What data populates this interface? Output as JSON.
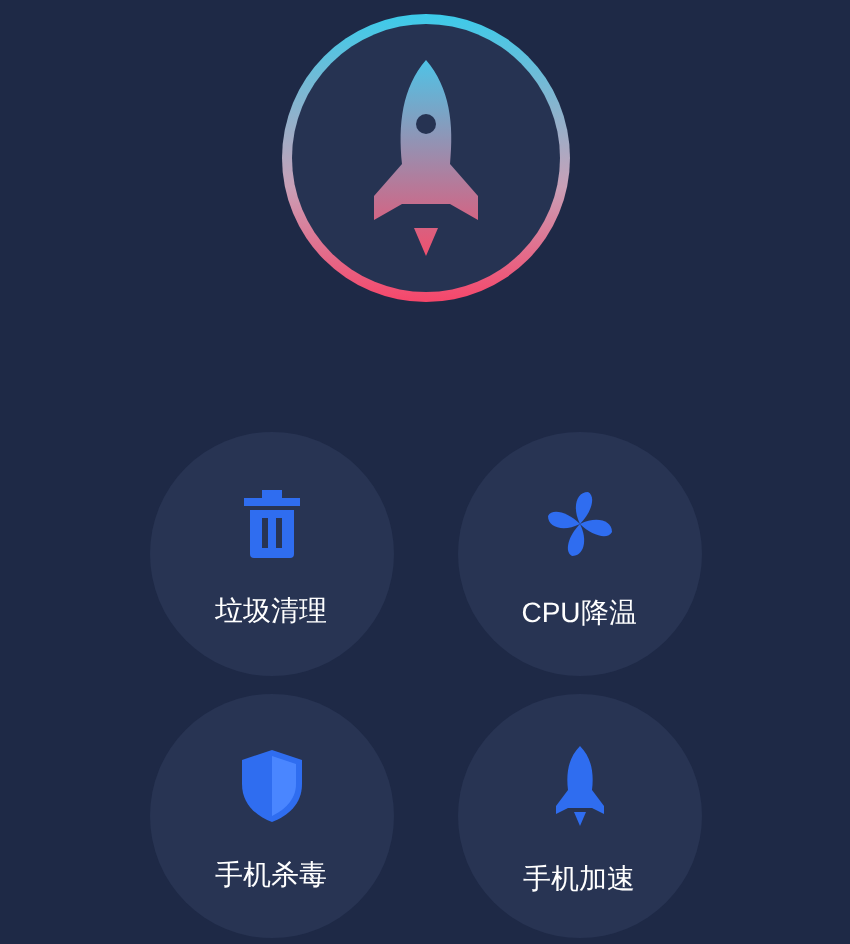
{
  "buttons": [
    {
      "label": "垃圾清理",
      "kind": "trash"
    },
    {
      "label": "CPU降温",
      "kind": "fan"
    },
    {
      "label": "手机杀毒",
      "kind": "shield"
    },
    {
      "label": "手机加速",
      "kind": "rocket"
    }
  ]
}
